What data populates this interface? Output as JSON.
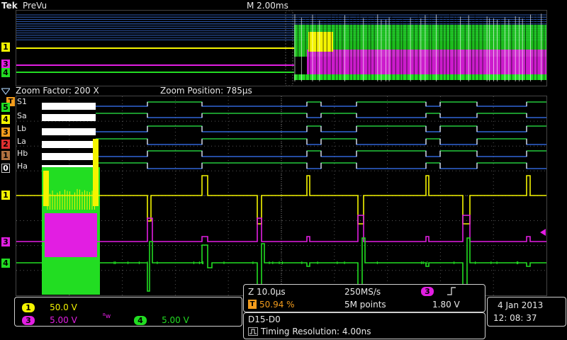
{
  "header": {
    "brand": "Tek",
    "mode": "PreVu",
    "timebase": "M 2.00ms",
    "trigger_marker": "T"
  },
  "zoom": {
    "factor": "Zoom Factor: 200 X",
    "position": "Zoom Position: 785µs"
  },
  "digital_labels": [
    "S1",
    "Sa",
    "Lb",
    "La",
    "Hb",
    "Ha"
  ],
  "left_markers": {
    "top_ch1": "1",
    "top_ch3": "3",
    "top_ch4": "4",
    "d5": "5",
    "d4": "4",
    "d3": "3",
    "d2": "2",
    "d1": "1",
    "d0": "0",
    "ch1": "1",
    "ch3": "3",
    "ch4": "4"
  },
  "channels": {
    "ch1": {
      "num": "1",
      "scale": "50.0 V",
      "color": "#f4f400"
    },
    "ch3": {
      "num": "3",
      "scale": "5.00 V",
      "color": "#e21ee2"
    },
    "bw_symbol": "ᴮw",
    "ch4": {
      "num": "4",
      "scale": "5.00 V",
      "color": "#22dd22"
    }
  },
  "acquisition": {
    "zoom_scale": "Z 10.0µs",
    "sample_rate": "250MS/s",
    "trigger_channel": "3",
    "trigger_slope": "⌠",
    "trigger_pos_icon": "T",
    "trigger_pos": "50.94 %",
    "record_length": "5M points",
    "trigger_level": "1.80 V"
  },
  "digital_info": {
    "bus": "D15-D0",
    "timing": "Timing Resolution: 4.00ns"
  },
  "datetime": {
    "date": "4 Jan   2013",
    "time": "12: 08: 37"
  },
  "colors": {
    "ch1": "#f4f400",
    "ch3": "#e21ee2",
    "ch4": "#22dd22",
    "digital": "#3a78ff",
    "digital_high": "#22dd22",
    "grid": "#555555",
    "trigger": "#f39c1c"
  }
}
